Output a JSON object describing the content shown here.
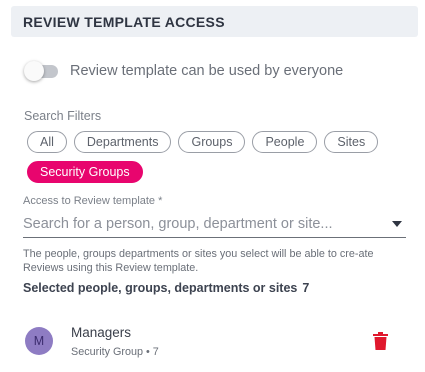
{
  "section": {
    "title": "REVIEW TEMPLATE ACCESS"
  },
  "toggle": {
    "label": "Review template can be used by everyone",
    "state": "off"
  },
  "filters": {
    "label": "Search Filters",
    "chips": [
      "All",
      "Departments",
      "Groups",
      "People",
      "Sites",
      "Security Groups"
    ],
    "active": "Security Groups",
    "active_color": "#e8056e"
  },
  "access": {
    "label": "Access to Review template *",
    "placeholder": "Search for a person, group, department or site..."
  },
  "help_text": "The people, groups departments or sites you select will be able to cre-ate Reviews using this Review template.",
  "selected": {
    "heading": "Selected people, groups, departments or sites",
    "count": "7",
    "items": [
      {
        "initial": "M",
        "name": "Managers",
        "meta": "Security Group • 7",
        "avatar_color": "#8e7cc3"
      }
    ]
  },
  "colors": {
    "delete_icon": "#e0182d"
  }
}
